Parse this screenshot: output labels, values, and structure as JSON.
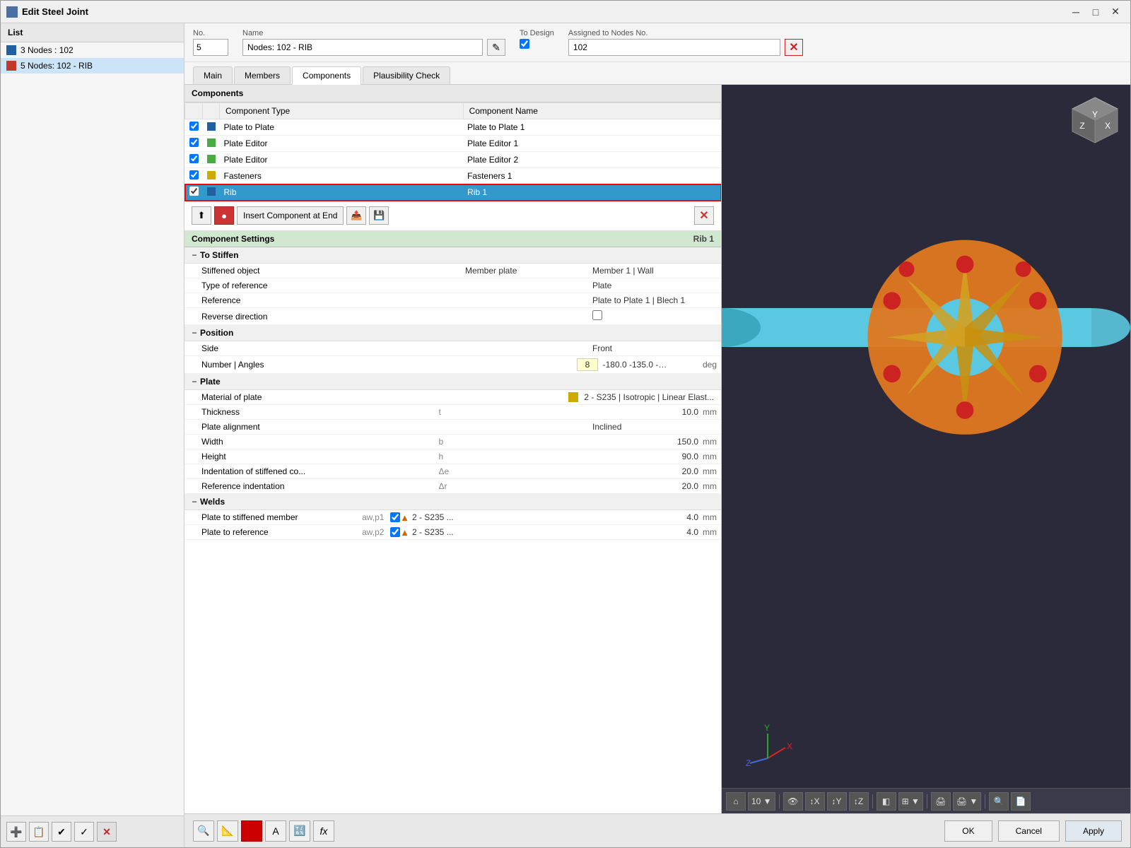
{
  "window": {
    "title": "Edit Steel Joint",
    "min_label": "─",
    "max_label": "□",
    "close_label": "✕"
  },
  "header": {
    "no_label": "No.",
    "no_value": "5",
    "name_label": "Name",
    "name_value": "Nodes: 102 - RIB",
    "to_design_label": "To Design",
    "to_design_checked": true,
    "assigned_label": "Assigned to Nodes No.",
    "assigned_value": "102"
  },
  "tabs": [
    {
      "id": "main",
      "label": "Main"
    },
    {
      "id": "members",
      "label": "Members"
    },
    {
      "id": "components",
      "label": "Components"
    },
    {
      "id": "plausibility",
      "label": "Plausibility Check"
    }
  ],
  "active_tab": "components",
  "list": {
    "header": "List",
    "items": [
      {
        "id": 1,
        "label": "3 Nodes : 102",
        "color": "blue"
      },
      {
        "id": 2,
        "label": "5 Nodes: 102 - RIB",
        "color": "red",
        "selected": true
      }
    ]
  },
  "components_section": {
    "title": "Components",
    "col_type": "Component Type",
    "col_name": "Component Name",
    "rows": [
      {
        "checked": true,
        "color": "blue-sq",
        "type": "Plate to Plate",
        "name": "Plate to Plate 1",
        "selected": false
      },
      {
        "checked": true,
        "color": "green-sq",
        "type": "Plate Editor",
        "name": "Plate Editor 1",
        "selected": false
      },
      {
        "checked": true,
        "color": "green-sq",
        "type": "Plate Editor",
        "name": "Plate Editor 2",
        "selected": false
      },
      {
        "checked": true,
        "color": "yellow-sq",
        "type": "Fasteners",
        "name": "Fasteners 1",
        "selected": false
      },
      {
        "checked": true,
        "color": "blue-sq",
        "type": "Rib",
        "name": "Rib 1",
        "selected": true
      }
    ]
  },
  "toolbar": {
    "insert_end_label": "Insert Component at End",
    "save_label": "💾",
    "delete_label": "✕"
  },
  "component_settings": {
    "title": "Component Settings",
    "subtitle": "Rib 1",
    "sections": {
      "to_stiffen": {
        "label": "To Stiffen",
        "fields": [
          {
            "label": "Stiffened object",
            "value": "Member plate",
            "value2": "Member 1 | Wall"
          },
          {
            "label": "Type of reference",
            "value": "Plate",
            "value2": ""
          },
          {
            "label": "Reference",
            "value": "Plate to Plate 1 | Blech 1",
            "value2": ""
          },
          {
            "label": "Reverse direction",
            "value": "",
            "value2": "",
            "checkbox": true
          }
        ]
      },
      "position": {
        "label": "Position",
        "fields": [
          {
            "label": "Side",
            "value": "Front",
            "value2": ""
          },
          {
            "label": "Number | Angles",
            "value": "8",
            "value2": "-180.0  -135.0 -…",
            "unit": "deg"
          }
        ]
      },
      "plate": {
        "label": "Plate",
        "fields": [
          {
            "label": "Material of plate",
            "value": "2 - S235 | Isotropic | Linear Elast...",
            "value2": ""
          },
          {
            "label": "Thickness",
            "param": "t",
            "value": "10.0",
            "unit": "mm"
          },
          {
            "label": "Plate alignment",
            "value": "Inclined",
            "value2": ""
          },
          {
            "label": "Width",
            "param": "b",
            "value": "150.0",
            "unit": "mm"
          },
          {
            "label": "Height",
            "param": "h",
            "value": "90.0",
            "unit": "mm"
          },
          {
            "label": "Indentation of stiffened co...",
            "param": "Δe",
            "value": "20.0",
            "unit": "mm"
          },
          {
            "label": "Reference indentation",
            "param": "Δr",
            "value": "20.0",
            "unit": "mm"
          }
        ]
      },
      "welds": {
        "label": "Welds",
        "fields": [
          {
            "label": "Plate to stiffened member",
            "param": "aw,p1",
            "mat": "2 - S235 ...",
            "value": "4.0",
            "unit": "mm"
          },
          {
            "label": "Plate to reference",
            "param": "aw,p2",
            "mat": "2 - S235 ...",
            "value": "4.0",
            "unit": "mm"
          }
        ]
      }
    }
  },
  "bottom_bar": {
    "ok_label": "OK",
    "cancel_label": "Cancel",
    "apply_label": "Apply"
  },
  "viewport": {
    "bg_color": "#2a2a3a"
  },
  "footer_btns": [
    "➕",
    "📋",
    "✔",
    "✖"
  ],
  "bottom_tools": [
    "🔍",
    "📐",
    "🔴",
    "A",
    "🔣",
    "fx"
  ]
}
